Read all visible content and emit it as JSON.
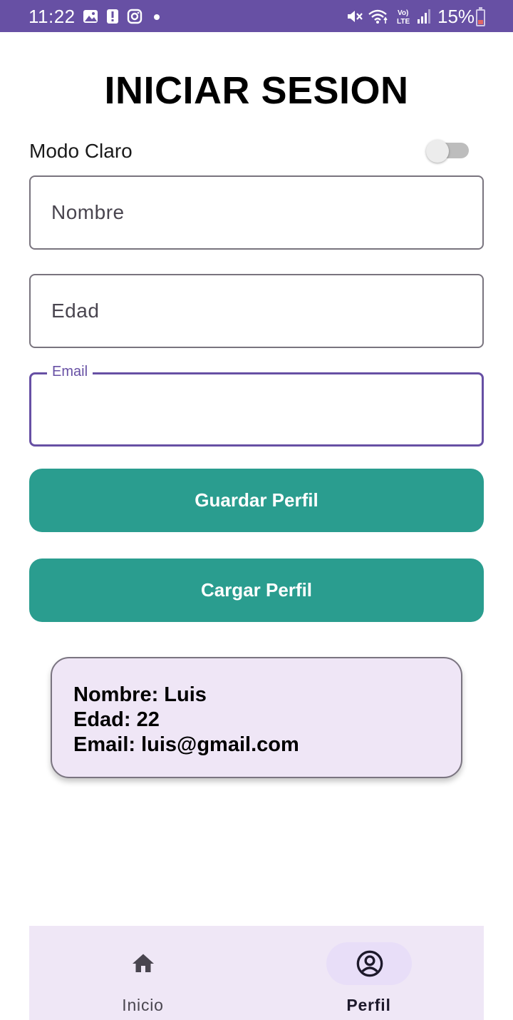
{
  "status_bar": {
    "time": "11:22",
    "battery_percent": "15%",
    "left_icons": [
      "gallery-icon",
      "alert-icon",
      "instagram-icon",
      "dot-icon"
    ],
    "right_icons": [
      "mute-icon",
      "wifi-icon",
      "volte-icon",
      "signal-icon",
      "battery-icon"
    ]
  },
  "page": {
    "title": "INICIAR SESION"
  },
  "theme_toggle": {
    "label": "Modo Claro",
    "checked": false
  },
  "form": {
    "nombre": {
      "placeholder": "Nombre",
      "value": ""
    },
    "edad": {
      "placeholder": "Edad",
      "value": ""
    },
    "email": {
      "label": "Email",
      "value": "",
      "focused": true
    }
  },
  "buttons": {
    "save_label": "Guardar Perfil",
    "load_label": "Cargar Perfil"
  },
  "profile_card": {
    "nombre": "Nombre: Luis",
    "edad": "Edad: 22",
    "email": "Email: luis@gmail.com"
  },
  "bottom_nav": {
    "items": [
      {
        "label": "Inicio",
        "icon": "home-icon",
        "selected": false
      },
      {
        "label": "Perfil",
        "icon": "account-circle-icon",
        "selected": true
      }
    ]
  },
  "colors": {
    "status_bar": "#6750a4",
    "focused_outline": "#6750a4",
    "button_bg": "#2a9d8f",
    "card_bg": "#efe6f6",
    "nav_bg": "#efe7f6",
    "nav_indicator": "#e8def8"
  }
}
